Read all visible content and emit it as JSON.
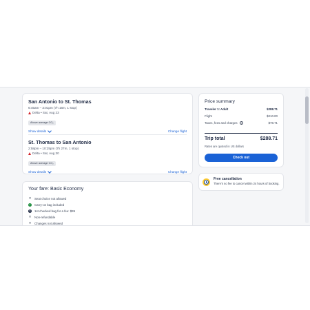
{
  "flights": [
    {
      "title": "San Antonio to St. Thomas",
      "time": "6:45am – 3:01pm (7h 16m, 1 stop)",
      "airline": "Delta • Sat, Aug 23",
      "badge": "Above average CO₂",
      "show_details": "Show details",
      "change": "Change flight"
    },
    {
      "title": "St. Thomas to San Antonio",
      "time": "2:58pm – 10:25pm (7h 27m, 1 stop)",
      "airline": "Delta • Sat, Aug 30",
      "badge": "Above average CO₂",
      "show_details": "Show details",
      "change": "Change flight"
    }
  ],
  "fare": {
    "title": "Your fare: Basic Economy",
    "items": [
      {
        "icon": "x-icon",
        "text": "Seat choice not allowed"
      },
      {
        "icon": "check-icon",
        "text": "Carry-on bag included"
      },
      {
        "icon": "dollar-icon",
        "text": "1st checked bag for a fee: $35"
      },
      {
        "icon": "x-icon",
        "text": "Non-refundable"
      },
      {
        "icon": "x-icon",
        "text": "Changes not allowed"
      }
    ]
  },
  "price": {
    "title": "Price summary",
    "traveler_label": "Traveler 1: Adult",
    "traveler_value": "$288.71",
    "flight_label": "Flight",
    "flight_value": "$210.00",
    "taxes_label": "Taxes, fees and charges",
    "taxes_value": "$78.71",
    "total_label": "Trip total",
    "total_value": "$288.71",
    "rates_note": "Rates are quoted in US dollars",
    "checkout": "Check out"
  },
  "cancellation": {
    "title": "Free cancellation",
    "text": "There's no fee to cancel within 24 hours of booking."
  },
  "colors": {
    "accent": "#1a62d6",
    "airline": "#d2232a",
    "check": "#1e8e3e",
    "clock": "#ffcc33"
  }
}
